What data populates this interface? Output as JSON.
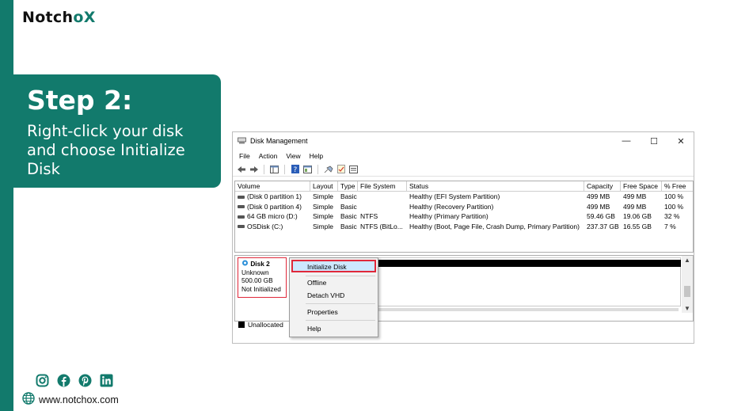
{
  "brand": {
    "logo_prefix": "Notch",
    "logo_o": "o",
    "logo_x": "X",
    "accent": "#127a6c"
  },
  "step": {
    "title": "Step 2:",
    "description": "Right-click your disk and choose Initialize Disk"
  },
  "footer": {
    "website": "www.notchox.com",
    "social_icons": [
      "instagram-icon",
      "facebook-icon",
      "pinterest-icon",
      "linkedin-icon"
    ]
  },
  "window": {
    "title": "Disk Management",
    "controls": {
      "minimize": "—",
      "maximize": "☐",
      "close": "✕"
    },
    "menu": [
      "File",
      "Action",
      "View",
      "Help"
    ],
    "columns": [
      "Volume",
      "Layout",
      "Type",
      "File System",
      "Status",
      "Capacity",
      "Free Space",
      "% Free"
    ],
    "volumes": [
      [
        "(Disk 0 partition 1)",
        "Simple",
        "Basic",
        "",
        "Healthy (EFI System Partition)",
        "499 MB",
        "499 MB",
        "100 %"
      ],
      [
        "(Disk 0 partition 4)",
        "Simple",
        "Basic",
        "",
        "Healthy (Recovery Partition)",
        "499 MB",
        "499 MB",
        "100 %"
      ],
      [
        "64 GB micro (D:)",
        "Simple",
        "Basic",
        "NTFS",
        "Healthy (Primary Partition)",
        "59.46 GB",
        "19.06 GB",
        "32 %"
      ],
      [
        "OSDisk (C:)",
        "Simple",
        "Basic",
        "NTFS (BitLo...",
        "Healthy (Boot, Page File, Crash Dump, Primary Partition)",
        "237.37 GB",
        "16.55 GB",
        "7 %"
      ]
    ],
    "disk": {
      "name": "Disk 2",
      "type": "Unknown",
      "size": "500.00 GB",
      "state": "Not Initialized"
    },
    "legend": {
      "unallocated": "Unallocated"
    }
  },
  "context_menu": {
    "initialize": "Initialize Disk",
    "offline": "Offline",
    "detach": "Detach VHD",
    "properties": "Properties",
    "help": "Help"
  }
}
